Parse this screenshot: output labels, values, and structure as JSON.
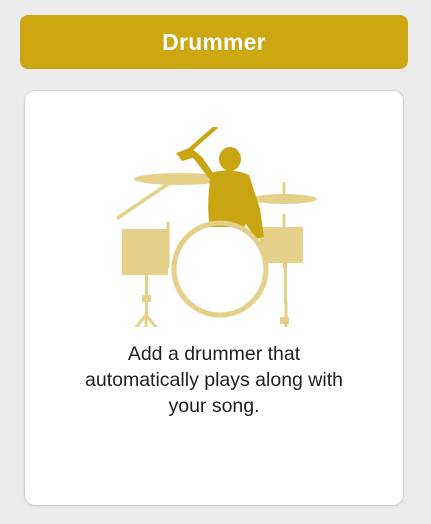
{
  "colors": {
    "background": "#ececec",
    "header_background": "#cca712",
    "header_text": "#ffffff",
    "card_background": "#ffffff",
    "drummer_figure": "#c9a514",
    "drum_kit": "#e5d08a",
    "description_text": "#1f1f1f"
  },
  "header": {
    "title": "Drummer"
  },
  "card": {
    "icon": "drummer-icon",
    "description_line1": "Add a drummer that",
    "description_line2": "automatically plays along with",
    "description_line3": "your song."
  }
}
